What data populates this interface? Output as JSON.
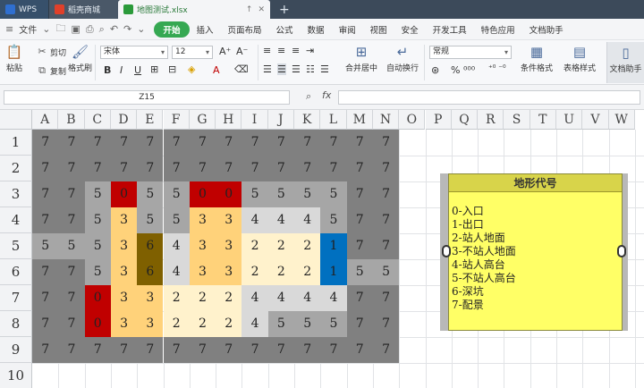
{
  "tabs": [
    {
      "label": "WPS",
      "color": "#2f6fd0"
    },
    {
      "label": "稻壳商城",
      "color": "#e0402a"
    },
    {
      "label": "地图测试.xlsx",
      "color": "#2a9a3a"
    }
  ],
  "new_tab_glyph": "+",
  "menu": {
    "file_label": "文件",
    "items": [
      "开始",
      "插入",
      "页面布局",
      "公式",
      "数据",
      "审阅",
      "视图",
      "安全",
      "开发工具",
      "特色应用",
      "文档助手"
    ],
    "active_index": 0
  },
  "ribbon": {
    "paste": "粘贴",
    "cut": "剪切",
    "copy": "复制",
    "format_painter": "格式刷",
    "font_name": "宋体",
    "font_size": "12",
    "merge_center": "合并居中",
    "wrap_text": "自动换行",
    "number_format": "常规",
    "conditional_format": "条件格式",
    "table_style": "表格样式",
    "doc_assistant": "文档助手",
    "bold": "B",
    "italic": "I",
    "underline": "U",
    "percent_symbols": "% ⁰⁰⁰",
    "decimal_symbols": "⁺⁰ ⁻⁰"
  },
  "formula_bar": {
    "name_box": "Z15",
    "fx_label": "fx",
    "value": ""
  },
  "grid": {
    "columns": [
      "A",
      "B",
      "C",
      "D",
      "E",
      "F",
      "G",
      "H",
      "I",
      "J",
      "K",
      "L",
      "M",
      "N",
      "O",
      "P",
      "Q",
      "R",
      "S",
      "T",
      "U",
      "V",
      "W"
    ],
    "rows": [
      "1",
      "2",
      "3",
      "4",
      "5",
      "6",
      "7",
      "8",
      "9",
      "10"
    ],
    "values": [
      [
        "7",
        "7",
        "7",
        "7",
        "7",
        "7",
        "7",
        "7",
        "7",
        "7",
        "7",
        "7",
        "7",
        "7"
      ],
      [
        "7",
        "7",
        "7",
        "7",
        "7",
        "7",
        "7",
        "7",
        "7",
        "7",
        "7",
        "7",
        "7",
        "7"
      ],
      [
        "7",
        "7",
        "5",
        "0",
        "5",
        "5",
        "0",
        "0",
        "5",
        "5",
        "5",
        "5",
        "7",
        "7"
      ],
      [
        "7",
        "7",
        "5",
        "3",
        "5",
        "5",
        "3",
        "3",
        "4",
        "4",
        "4",
        "5",
        "7",
        "7"
      ],
      [
        "5",
        "5",
        "5",
        "3",
        "6",
        "4",
        "3",
        "3",
        "2",
        "2",
        "2",
        "1",
        "7",
        "7"
      ],
      [
        "7",
        "7",
        "5",
        "3",
        "6",
        "4",
        "3",
        "3",
        "2",
        "2",
        "2",
        "1",
        "5",
        "5"
      ],
      [
        "7",
        "7",
        "0",
        "3",
        "3",
        "2",
        "2",
        "2",
        "4",
        "4",
        "4",
        "4",
        "7",
        "7"
      ],
      [
        "7",
        "7",
        "0",
        "3",
        "3",
        "2",
        "2",
        "2",
        "4",
        "5",
        "5",
        "5",
        "7",
        "7"
      ],
      [
        "7",
        "7",
        "7",
        "7",
        "7",
        "7",
        "7",
        "7",
        "7",
        "7",
        "7",
        "7",
        "7",
        "7"
      ]
    ],
    "value_colors": {
      "0": "#c00000",
      "1": "#0070c0",
      "2": "#fff2cc",
      "3": "#ffd27a",
      "4": "#d9d9d9",
      "5": "#a6a6a6",
      "6": "#7f6000",
      "7": "#808080"
    }
  },
  "note": {
    "title": "地形代号",
    "items": [
      "0-入口",
      "1-出口",
      "2-站人地面",
      "3-不站人地面",
      "4-站人高台",
      "5-不站人高台",
      "6-深坑",
      "7-配景"
    ]
  }
}
